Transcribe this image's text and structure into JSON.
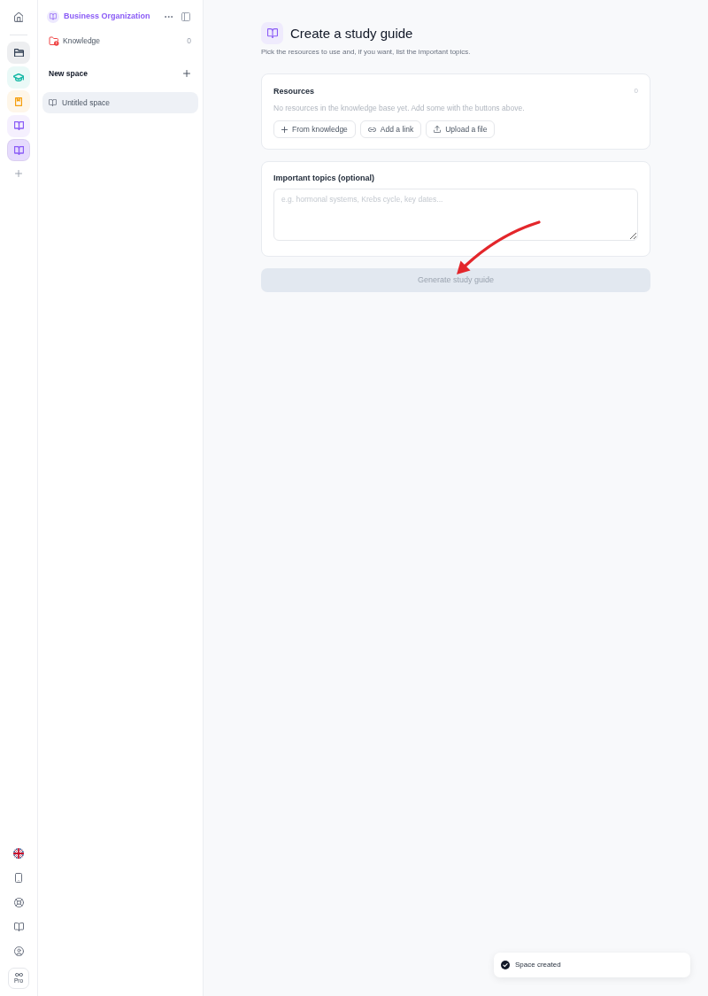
{
  "rail": {
    "spaces": [
      {
        "kind": "folder",
        "color": "#334155",
        "selected": false
      },
      {
        "kind": "course",
        "color": "#14b8a6",
        "selected": false
      },
      {
        "kind": "notebook",
        "color": "#f59e0b",
        "selected": false
      },
      {
        "kind": "book",
        "color": "#8b5cf6",
        "selected": false
      },
      {
        "kind": "book",
        "color": "#8b5cf6",
        "selected": true
      }
    ],
    "pro_label": "Pro"
  },
  "sidebar": {
    "workspace": "Business Organization",
    "items": [
      {
        "label": "Knowledge",
        "count": "0"
      }
    ],
    "section_title": "New space",
    "spaces": [
      {
        "label": "Untitled space",
        "selected": true
      }
    ]
  },
  "page": {
    "title": "Create a study guide",
    "subtitle": "Pick the resources to use and, if you want, list the important topics."
  },
  "resources": {
    "title": "Resources",
    "count": "0",
    "empty_text": "No resources in the knowledge base yet. Add some with the buttons above.",
    "buttons": [
      {
        "kind": "add",
        "label": "From knowledge"
      },
      {
        "kind": "link",
        "label": "Add a link"
      },
      {
        "kind": "upload",
        "label": "Upload a file"
      }
    ]
  },
  "topics": {
    "label": "Important topics (optional)",
    "placeholder": "e.g. hormonal systems, Krebs cycle, key dates..."
  },
  "generate_button": {
    "label": "Generate study guide",
    "disabled": true
  },
  "toast": {
    "message": "Space created"
  }
}
